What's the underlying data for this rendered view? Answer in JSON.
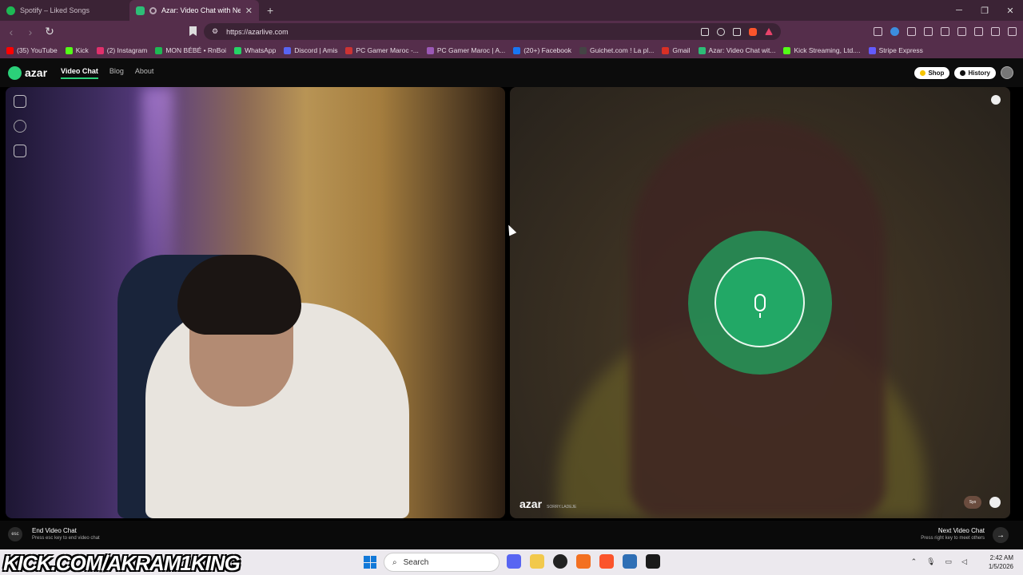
{
  "browser": {
    "tabs": [
      {
        "label": "Spotify – Liked Songs",
        "icon": "spotify-icon"
      },
      {
        "label": "Azar: Video Chat with New Pe",
        "icon": "azar-icon",
        "active": true
      }
    ],
    "url": "https://azarlive.com",
    "bookmarks": [
      "(35) YouTube",
      "Kick",
      "(2) Instagram",
      "MON BÉBÉ • RnBoi",
      "WhatsApp",
      "Discord | Amis",
      "PC Gamer Maroc -...",
      "PC Gamer Maroc | A...",
      "(20+) Facebook",
      "Guichet.com ! La pl...",
      "Gmail",
      "Azar: Video Chat wit...",
      "Kick Streaming, Ltd....",
      "Stripe Express"
    ]
  },
  "site": {
    "logo": "azar",
    "nav": [
      "Video Chat",
      "Blog",
      "About"
    ],
    "shop_label": "Shop",
    "history_label": "History"
  },
  "remote": {
    "watermark": "azar",
    "watermark_sub": "SORRY.LADEJE",
    "mini_label": "Syo"
  },
  "footer": {
    "esc_key": "esc",
    "end_title": "End Video Chat",
    "end_sub": "Press esc key to end video chat",
    "next_title": "Next Video Chat",
    "next_sub": "Press right key to meet others"
  },
  "taskbar": {
    "overlay_text": "KICK.COM/AKRAM1KING",
    "search_placeholder": "Search",
    "time": "2:42 AM",
    "date": "1/5/2026"
  },
  "colors": {
    "accent": "#2bd079",
    "browser": "#552e4b",
    "mic": "#22a866"
  }
}
